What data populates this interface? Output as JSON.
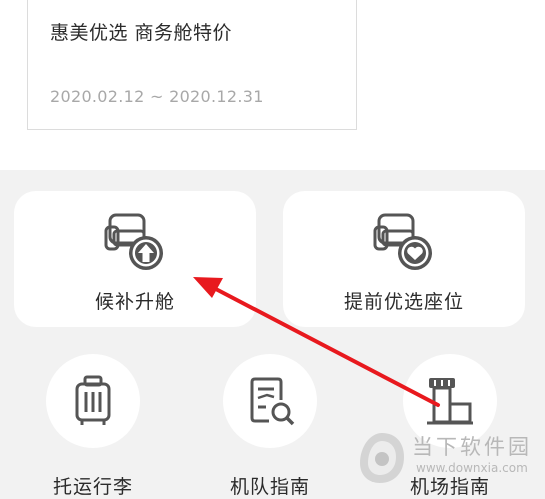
{
  "promo": {
    "title": "惠美优选 商务舱特价",
    "date_range": "2020.02.12 ~ 2020.12.31"
  },
  "services": {
    "upgrade": {
      "label": "候补升舱",
      "icon": "seat-upgrade-icon"
    },
    "seat": {
      "label": "提前优选座位",
      "icon": "seat-favorite-icon"
    }
  },
  "guides": {
    "luggage": {
      "label": "托运行李",
      "icon": "luggage-icon"
    },
    "fleet": {
      "label": "机队指南",
      "icon": "fleet-guide-icon"
    },
    "airport": {
      "label": "机场指南",
      "icon": "airport-tower-icon"
    }
  },
  "watermark": {
    "text": "当下软件园",
    "url": "www.downxia.com"
  },
  "colors": {
    "icon": "#555555",
    "annotation_arrow": "#e8191e",
    "background": "#f2f2f2"
  }
}
